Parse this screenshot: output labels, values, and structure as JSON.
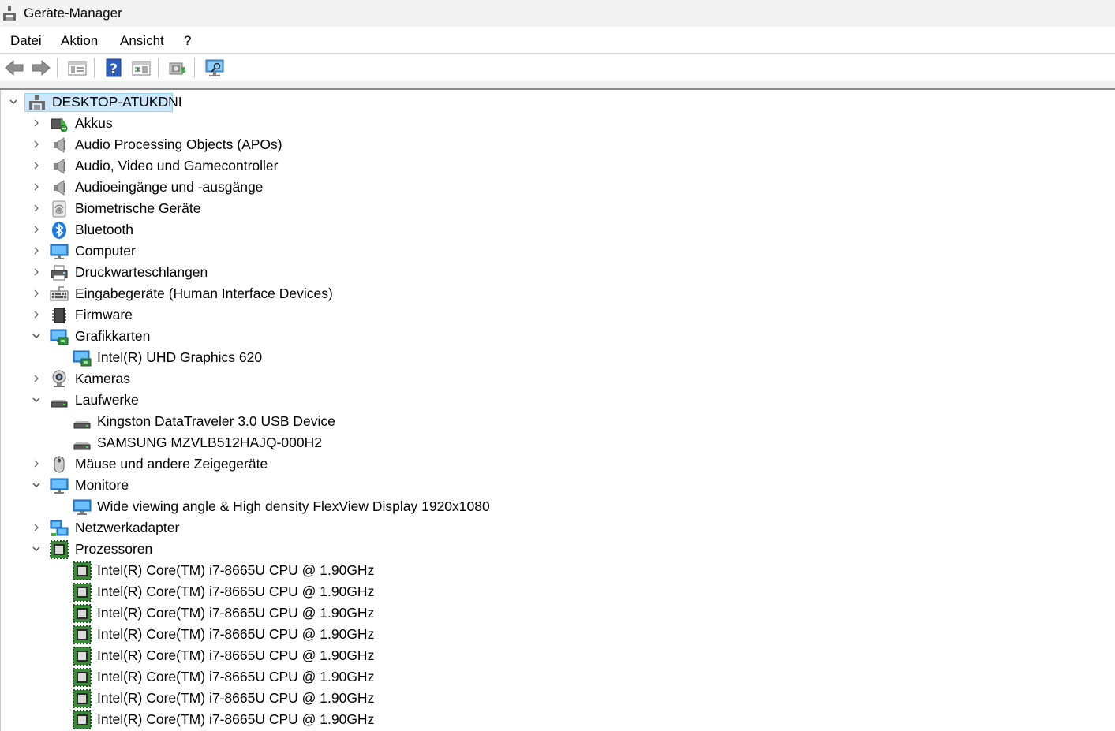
{
  "window": {
    "title": "Geräte-Manager"
  },
  "menu": [
    "Datei",
    "Aktion",
    "Ansicht",
    "?"
  ],
  "toolbar": [
    "back-icon",
    "forward-icon",
    "properties-view-icon",
    "help-icon",
    "show-hidden-icon",
    "update-driver-icon",
    "scan-hardware-icon"
  ],
  "tree": {
    "root": "DESKTOP-ATUKDNI",
    "categories": [
      {
        "label": "Akkus",
        "icon": "battery-icon",
        "expanded": false,
        "children": []
      },
      {
        "label": "Audio Processing Objects (APOs)",
        "icon": "speaker-icon",
        "expanded": false,
        "children": []
      },
      {
        "label": "Audio, Video und Gamecontroller",
        "icon": "speaker-icon",
        "expanded": false,
        "children": []
      },
      {
        "label": "Audioeingänge und -ausgänge",
        "icon": "speaker-icon",
        "expanded": false,
        "children": []
      },
      {
        "label": "Biometrische Geräte",
        "icon": "fingerprint-icon",
        "expanded": false,
        "children": []
      },
      {
        "label": "Bluetooth",
        "icon": "bluetooth-icon",
        "expanded": false,
        "children": []
      },
      {
        "label": "Computer",
        "icon": "monitor-icon",
        "expanded": false,
        "children": []
      },
      {
        "label": "Druckwarteschlangen",
        "icon": "printer-icon",
        "expanded": false,
        "children": []
      },
      {
        "label": "Eingabegeräte (Human Interface Devices)",
        "icon": "keyboard-icon",
        "expanded": false,
        "children": []
      },
      {
        "label": "Firmware",
        "icon": "chip-icon",
        "expanded": false,
        "children": []
      },
      {
        "label": "Grafikkarten",
        "icon": "display-adapter-icon",
        "expanded": true,
        "children": [
          {
            "label": "Intel(R) UHD Graphics 620",
            "icon": "display-adapter-icon"
          }
        ]
      },
      {
        "label": "Kameras",
        "icon": "camera-icon",
        "expanded": false,
        "children": []
      },
      {
        "label": "Laufwerke",
        "icon": "drive-icon",
        "expanded": true,
        "children": [
          {
            "label": "Kingston DataTraveler 3.0 USB Device",
            "icon": "drive-icon"
          },
          {
            "label": "SAMSUNG MZVLB512HAJQ-000H2",
            "icon": "drive-icon"
          }
        ]
      },
      {
        "label": "Mäuse und andere Zeigegeräte",
        "icon": "mouse-icon",
        "expanded": false,
        "children": []
      },
      {
        "label": "Monitore",
        "icon": "monitor-icon",
        "expanded": true,
        "children": [
          {
            "label": "Wide viewing angle & High density FlexView Display 1920x1080",
            "icon": "monitor-icon"
          }
        ]
      },
      {
        "label": "Netzwerkadapter",
        "icon": "network-icon",
        "expanded": false,
        "children": []
      },
      {
        "label": "Prozessoren",
        "icon": "processor-icon",
        "expanded": true,
        "children": [
          {
            "label": "Intel(R) Core(TM) i7-8665U CPU @ 1.90GHz",
            "icon": "processor-icon"
          },
          {
            "label": "Intel(R) Core(TM) i7-8665U CPU @ 1.90GHz",
            "icon": "processor-icon"
          },
          {
            "label": "Intel(R) Core(TM) i7-8665U CPU @ 1.90GHz",
            "icon": "processor-icon"
          },
          {
            "label": "Intel(R) Core(TM) i7-8665U CPU @ 1.90GHz",
            "icon": "processor-icon"
          },
          {
            "label": "Intel(R) Core(TM) i7-8665U CPU @ 1.90GHz",
            "icon": "processor-icon"
          },
          {
            "label": "Intel(R) Core(TM) i7-8665U CPU @ 1.90GHz",
            "icon": "processor-icon"
          },
          {
            "label": "Intel(R) Core(TM) i7-8665U CPU @ 1.90GHz",
            "icon": "processor-icon"
          },
          {
            "label": "Intel(R) Core(TM) i7-8665U CPU @ 1.90GHz",
            "icon": "processor-icon"
          }
        ]
      }
    ]
  }
}
